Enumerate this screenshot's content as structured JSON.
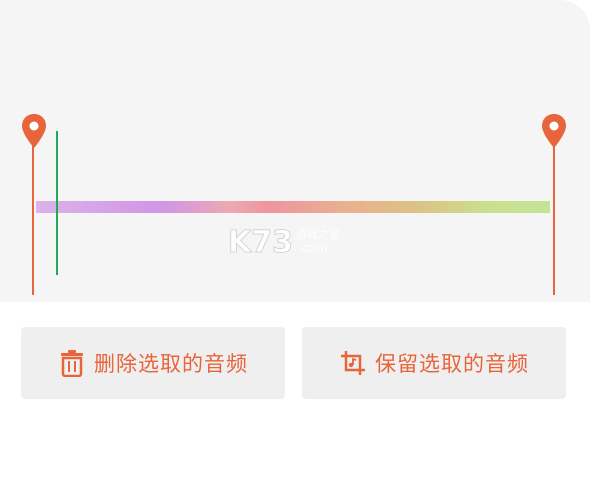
{
  "colors": {
    "accent": "#e8643a",
    "playhead": "#22aa55",
    "panel_background": "#f5f5f5",
    "button_background": "#efefef",
    "wave_gradient": [
      "#c77be0",
      "#b347d9",
      "#e86a7a",
      "#e8455a",
      "#e0783a",
      "#c79a2a",
      "#a8cf3a",
      "#9bd44a"
    ]
  },
  "waveform": {
    "start_marker_icon": "map-pin-icon",
    "end_marker_icon": "map-pin-icon",
    "playhead_color": "#22aa55"
  },
  "watermark": {
    "brand": "K73",
    "sub": "游戏之家",
    "domain": ".com"
  },
  "actions": {
    "delete_label": "删除选取的音频",
    "delete_icon": "trash-icon",
    "keep_label": "保留选取的音频",
    "keep_icon": "crop-icon"
  }
}
